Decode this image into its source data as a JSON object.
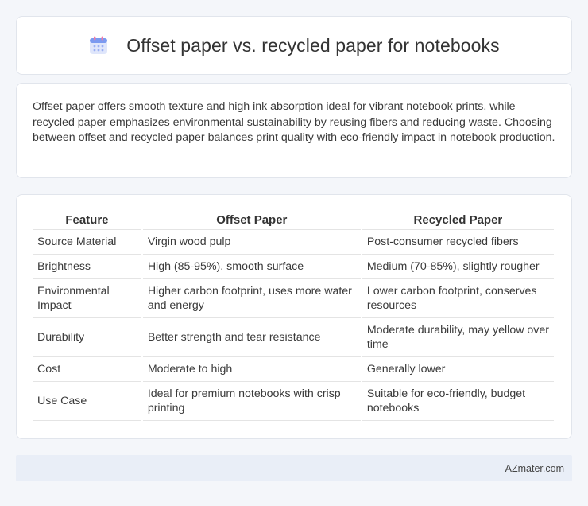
{
  "header": {
    "title": "Offset paper vs. recycled paper for notebooks",
    "icon": "calendar-icon"
  },
  "description": "Offset paper offers smooth texture and high ink absorption ideal for vibrant notebook prints, while recycled paper emphasizes environmental sustainability by reusing fibers and reducing waste. Choosing between offset and recycled paper balances print quality with eco-friendly impact in notebook production.",
  "table": {
    "headers": [
      "Feature",
      "Offset Paper",
      "Recycled Paper"
    ],
    "rows": [
      [
        "Source Material",
        "Virgin wood pulp",
        "Post-consumer recycled fibers"
      ],
      [
        "Brightness",
        "High (85-95%), smooth surface",
        "Medium (70-85%), slightly rougher"
      ],
      [
        "Environmental Impact",
        "Higher carbon footprint, uses more water and energy",
        "Lower carbon footprint, conserves resources"
      ],
      [
        "Durability",
        "Better strength and tear resistance",
        "Moderate durability, may yellow over time"
      ],
      [
        "Cost",
        "Moderate to high",
        "Generally lower"
      ],
      [
        "Use Case",
        "Ideal for premium notebooks with crisp printing",
        "Suitable for eco-friendly, budget notebooks"
      ]
    ]
  },
  "footer": {
    "brand": "AZmater.com"
  },
  "colors": {
    "background": "#f4f6fa",
    "card": "#ffffff",
    "footer": "#e9eef7",
    "icon_accent": "#6c8ef5"
  }
}
